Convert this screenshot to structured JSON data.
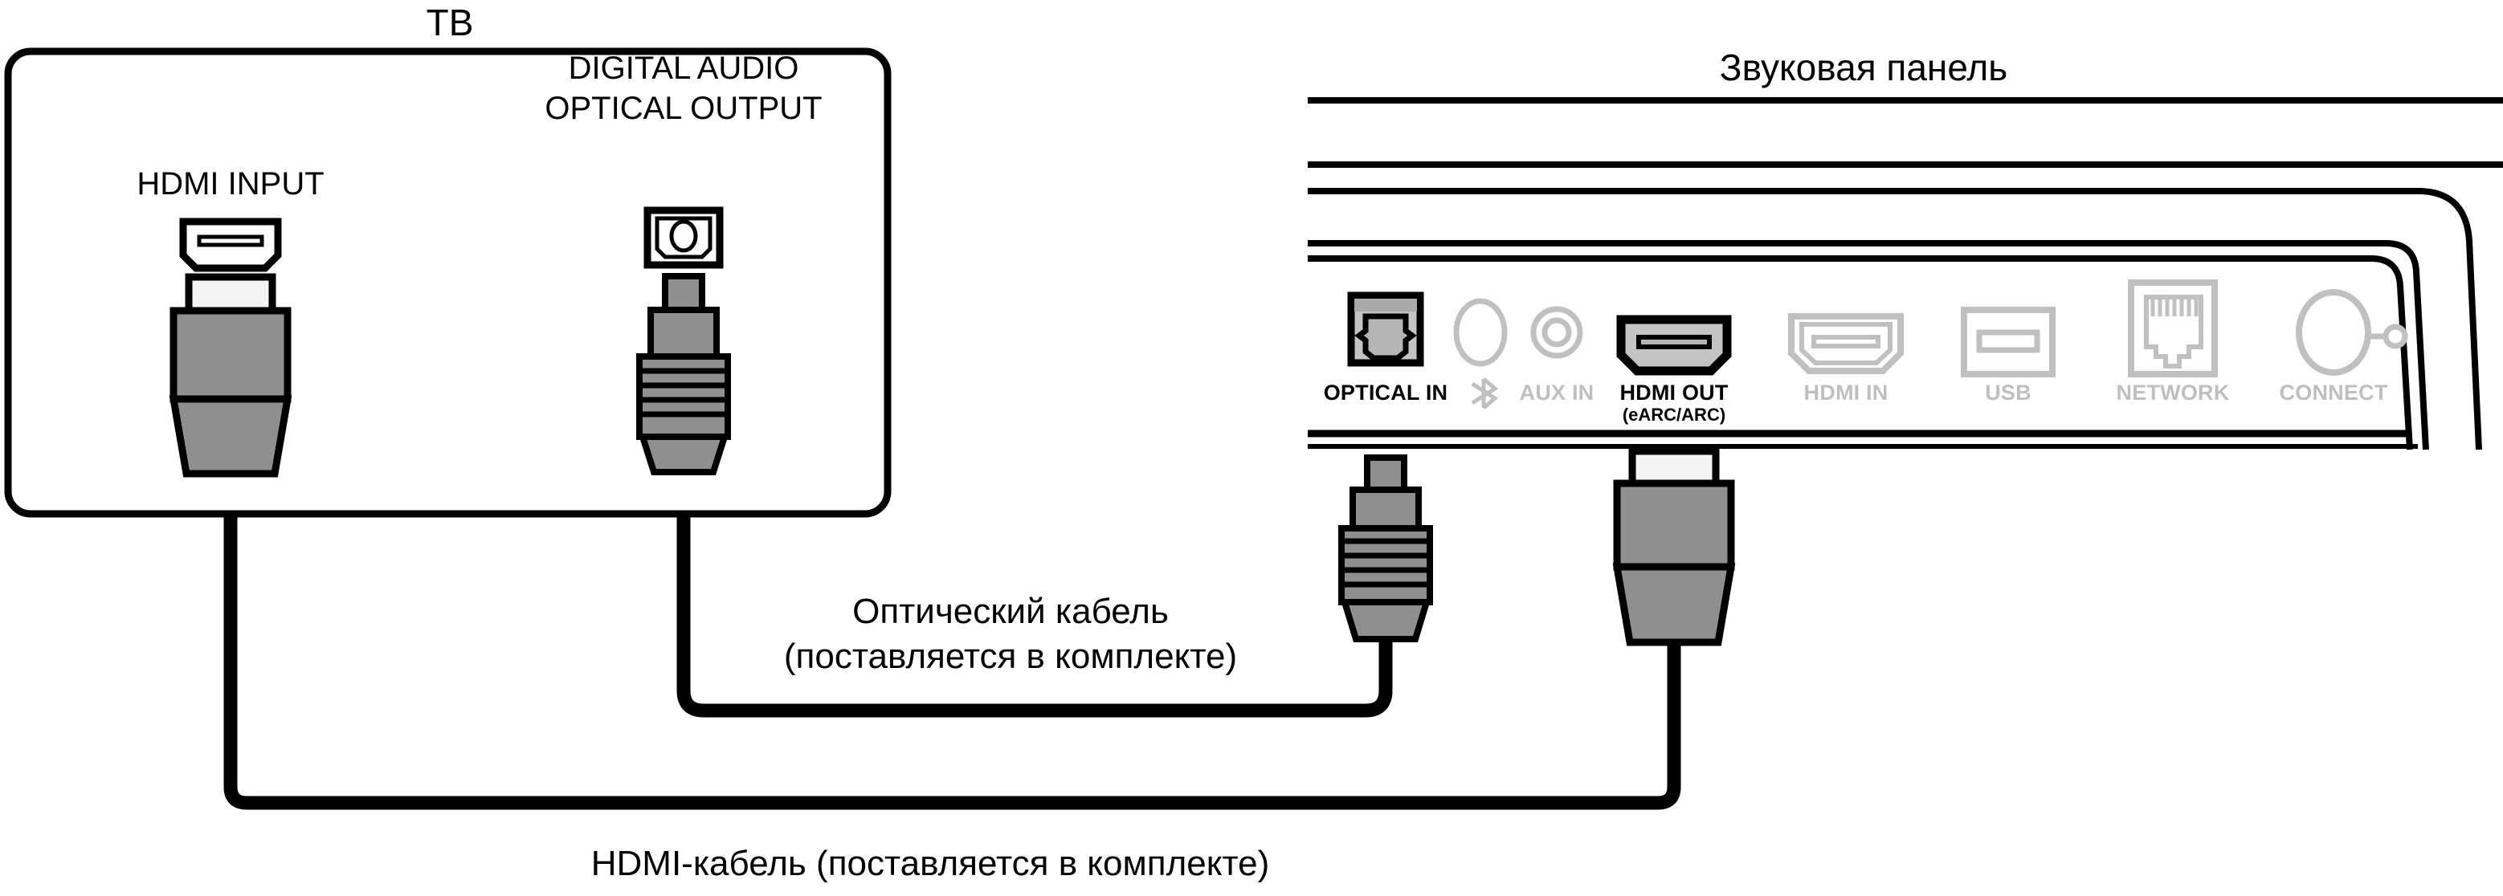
{
  "diagram": {
    "type": "device-connection-diagram",
    "language": "ru",
    "tv": {
      "title": "ТВ",
      "ports": [
        {
          "name": "hdmi-input",
          "label": "HDMI INPUT",
          "icon": "hdmi-port-icon",
          "state": "active",
          "connected_cable": "hdmi"
        },
        {
          "name": "digital-audio-optical-output",
          "label_line1": "DIGITAL AUDIO",
          "label_line2": "OPTICAL OUTPUT",
          "icon": "optical-toslink-port-icon",
          "state": "active",
          "connected_cable": "optical"
        }
      ]
    },
    "soundbar": {
      "title": "Звуковая панель",
      "ports": [
        {
          "name": "optical-in",
          "label": "OPTICAL IN",
          "sublabel": "",
          "icon": "optical-toslink-port-icon",
          "state": "active",
          "connected_cable": "optical"
        },
        {
          "name": "bluetooth",
          "label": "",
          "sublabel": "",
          "icon": "bluetooth-icon",
          "state": "dimmed",
          "connected_cable": ""
        },
        {
          "name": "aux-in",
          "label": "AUX IN",
          "sublabel": "",
          "icon": "aux-jack-icon",
          "state": "dimmed",
          "connected_cable": ""
        },
        {
          "name": "hdmi-out",
          "label": "HDMI OUT",
          "sublabel": "(eARC/ARC)",
          "icon": "hdmi-port-icon",
          "state": "active",
          "connected_cable": "hdmi"
        },
        {
          "name": "hdmi-in",
          "label": "HDMI IN",
          "sublabel": "",
          "icon": "hdmi-port-icon",
          "state": "dimmed",
          "connected_cable": ""
        },
        {
          "name": "usb",
          "label": "USB",
          "sublabel": "",
          "icon": "usb-port-icon",
          "state": "dimmed",
          "connected_cable": ""
        },
        {
          "name": "network",
          "label": "NETWORK",
          "sublabel": "",
          "icon": "rj45-ethernet-icon",
          "state": "dimmed",
          "connected_cable": ""
        },
        {
          "name": "connect",
          "label": "CONNECT",
          "sublabel": "",
          "icon": "connect-button-icon",
          "state": "dimmed",
          "connected_cable": ""
        }
      ]
    },
    "cables": [
      {
        "name": "optical-cable",
        "label_line1": "Оптический кабель",
        "label_line2": "(поставляется в комплекте)",
        "from": "tv.digital-audio-optical-output",
        "to": "soundbar.optical-in"
      },
      {
        "name": "hdmi-cable",
        "label_line1": "HDMI-кабель (поставляется в комплекте)",
        "label_line2": "",
        "from": "tv.hdmi-input",
        "to": "soundbar.hdmi-out"
      }
    ],
    "colors": {
      "outline": "#000000",
      "background": "#ffffff",
      "plug_body": "#8f8f8f",
      "plug_tip": "#f4f4f4",
      "port_fill_active": "#c4c4c4",
      "dimmed": "#c0c0c0"
    }
  }
}
